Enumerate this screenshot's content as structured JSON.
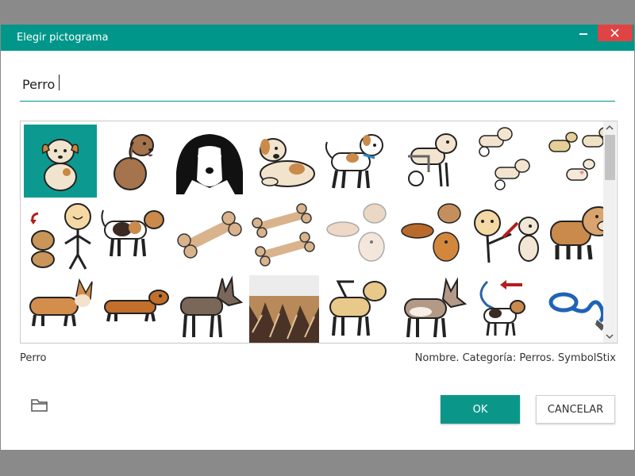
{
  "dialog": {
    "title": "Elegir pictograma",
    "accent_color": "#00968a",
    "close_color": "#e04343"
  },
  "search": {
    "value": "Perro"
  },
  "pictograms": [
    {
      "icon": "puppy-sitting-icon",
      "selected": true
    },
    {
      "icon": "brown-fluffy-dog-icon"
    },
    {
      "icon": "black-white-dog-face-icon"
    },
    {
      "icon": "dog-lying-down-icon"
    },
    {
      "icon": "dog-with-collar-icon"
    },
    {
      "icon": "dog-in-wheelchair-icon"
    },
    {
      "icon": "two-dogs-in-wheelchairs-icon"
    },
    {
      "icon": "group-of-dogs-icon"
    },
    {
      "icon": "dog-and-person-icon"
    },
    {
      "icon": "beagle-icon"
    },
    {
      "icon": "bone-icon"
    },
    {
      "icon": "two-bones-icon"
    },
    {
      "icon": "dog-breeds-pale-icon"
    },
    {
      "icon": "dog-breeds-icon"
    },
    {
      "icon": "person-petting-dog-icon"
    },
    {
      "icon": "bulldog-icon"
    },
    {
      "icon": "corgi-icon"
    },
    {
      "icon": "dachshund-icon"
    },
    {
      "icon": "doberman-icon"
    },
    {
      "icon": "dog-fur-icon"
    },
    {
      "icon": "guide-dog-icon"
    },
    {
      "icon": "husky-icon"
    },
    {
      "icon": "dog-on-leash-icon"
    },
    {
      "icon": "leash-icon"
    }
  ],
  "status": {
    "name": "Perro",
    "details": "Nombre. Categoría: Perros. SymbolStix"
  },
  "buttons": {
    "ok": "OK",
    "cancel": "CANCELAR"
  },
  "icons": {
    "folder": "folder-icon",
    "minimize": "minimize-icon",
    "close": "close-icon"
  }
}
